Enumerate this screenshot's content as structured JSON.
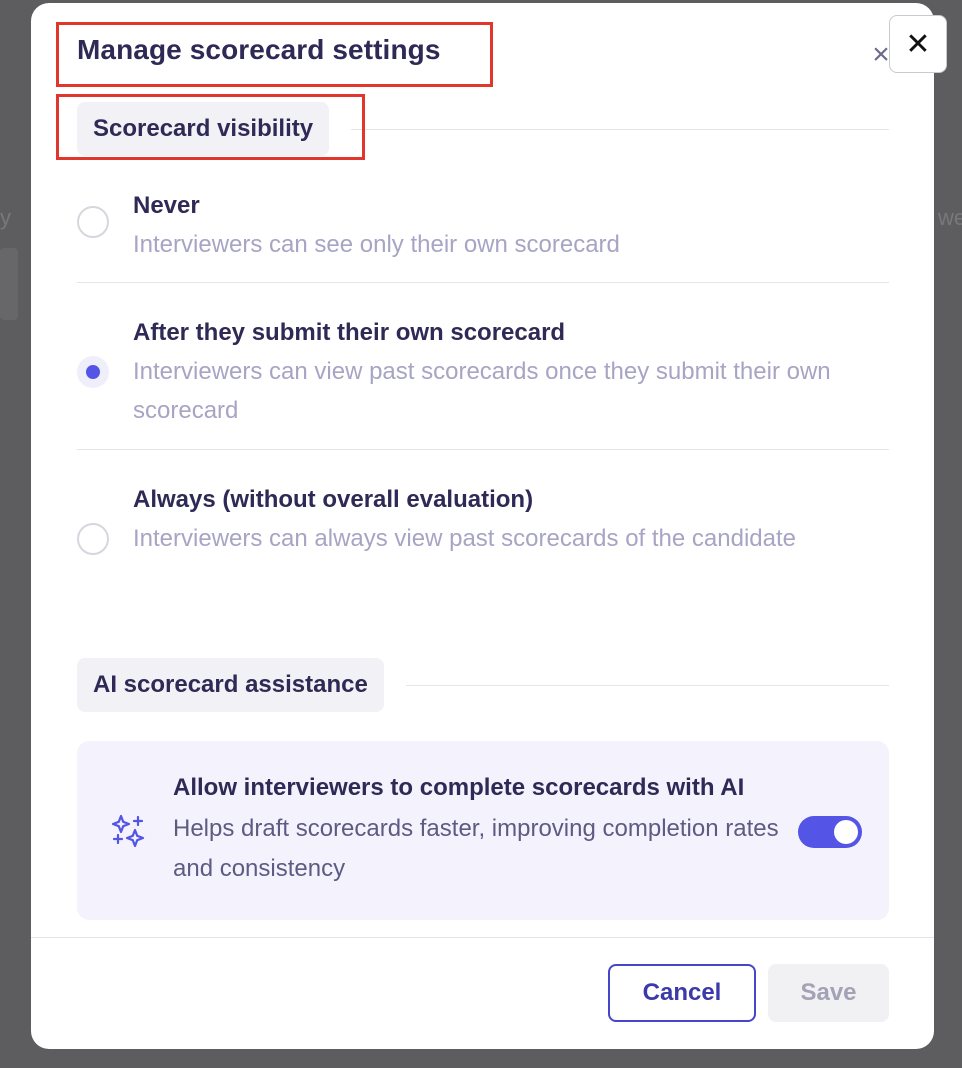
{
  "modal": {
    "title": "Manage scorecard settings",
    "title_close_glyph": "×",
    "overlay_close_glyph": "✕"
  },
  "visibility": {
    "heading": "Scorecard visibility",
    "selected_index": 1,
    "options": [
      {
        "label": "Never",
        "description": "Interviewers can see only their own scorecard",
        "checked": false
      },
      {
        "label": "After they submit their own scorecard",
        "description": "Interviewers can view past scorecards once they submit their own scorecard",
        "checked": true
      },
      {
        "label": "Always (without overall evaluation)",
        "description": "Interviewers can always view past scorecards of the candidate",
        "checked": false
      }
    ]
  },
  "ai": {
    "heading": "AI scorecard assistance",
    "icon": "sparkles-icon",
    "title": "Allow interviewers to complete scorecards with AI",
    "description": "Helps draft scorecards faster, improving completion rates and consistency",
    "enabled": true
  },
  "footer": {
    "cancel_label": "Cancel",
    "save_label": "Save"
  },
  "colors": {
    "accent": "#5454e6",
    "heading_text": "#2e2a55",
    "muted_text": "#a7a4c4",
    "annotation": "#e0362c"
  }
}
